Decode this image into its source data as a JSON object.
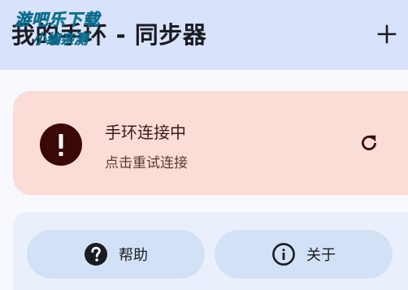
{
  "app_bar": {
    "title": "我的手环 - 同步器",
    "add_icon": "plus-icon"
  },
  "watermark": {
    "line1": "游吧乐下载",
    "line2": "小编亲测"
  },
  "status_card": {
    "title": "手环连接中",
    "subtitle": "点击重试连接",
    "status_icon": "error-icon",
    "action_icon": "refresh-icon",
    "background_color": "#fbdcd7"
  },
  "actions": {
    "help": {
      "label": "帮助",
      "icon": "help-icon"
    },
    "about": {
      "label": "关于",
      "icon": "info-icon"
    }
  },
  "colors": {
    "app_bar": "#d9e2fb",
    "page_background": "#f7f9ff",
    "error_badge": "#3a0907",
    "button_background": "#d3e1f6"
  }
}
